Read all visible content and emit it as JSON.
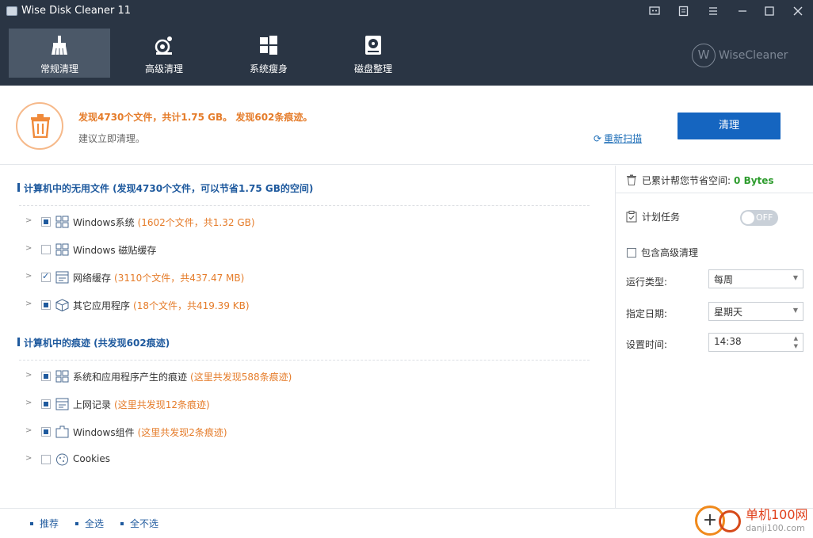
{
  "window": {
    "title": "Wise Disk Cleaner 11"
  },
  "nav": {
    "tabs": [
      {
        "label": "常规清理",
        "active": true,
        "icon": "broom-icon"
      },
      {
        "label": "高级清理",
        "active": false,
        "icon": "advanced-clean-icon"
      },
      {
        "label": "系统瘦身",
        "active": false,
        "icon": "windows-slim-icon"
      },
      {
        "label": "磁盘整理",
        "active": false,
        "icon": "disk-defrag-icon"
      }
    ],
    "brand": "WiseCleaner",
    "brand_mark": "W"
  },
  "summary": {
    "found_text": "发现4730个文件，共计1.75 GB。 发现602条痕迹。",
    "advice_text": "建议立即清理。",
    "rescan_label": "重新扫描",
    "clean_button": "清理"
  },
  "sections": [
    {
      "title": "计算机中的无用文件 (发现4730个文件，可以节省1.75 GB的空间)",
      "items": [
        {
          "label": "Windows系统",
          "info": "(1602个文件，共1.32 GB)",
          "check": "partial"
        },
        {
          "label": "Windows 磁贴缓存",
          "info": "",
          "check": "none"
        },
        {
          "label": "网络缓存",
          "info": "(3110个文件，共437.47 MB)",
          "check": "checked"
        },
        {
          "label": "其它应用程序",
          "info": "(18个文件，共419.39 KB)",
          "check": "partial"
        }
      ]
    },
    {
      "title": "计算机中的痕迹 (共发现602痕迹)",
      "items": [
        {
          "label": "系统和应用程序产生的痕迹",
          "info": "(这里共发现588条痕迹)",
          "check": "partial"
        },
        {
          "label": "上网记录",
          "info": "(这里共发现12条痕迹)",
          "check": "partial"
        },
        {
          "label": "Windows组件",
          "info": "(这里共发现2条痕迹)",
          "check": "partial"
        },
        {
          "label": "Cookies",
          "info": "",
          "check": "none"
        }
      ]
    }
  ],
  "right_panel": {
    "saved_label": "已累计帮您节省空间:",
    "saved_value": "0 Bytes",
    "schedule_label": "计划任务",
    "toggle_state": "OFF",
    "include_advanced_label": "包含高级清理",
    "run_type_label": "运行类型:",
    "run_type_value": "每周",
    "day_label": "指定日期:",
    "day_value": "星期天",
    "time_label": "设置时间:",
    "time_value": "14:38"
  },
  "footer": {
    "recommend": "推荐",
    "select_all": "全选",
    "select_none": "全不选"
  },
  "watermark": {
    "line1": "单机100网",
    "line2": "danji100.com"
  },
  "colors": {
    "topbar": "#2a3544",
    "accent_orange": "#e57c2a",
    "link_blue": "#1f5a9e",
    "button_blue": "#1565c0",
    "saved_green": "#2e9c2e"
  }
}
